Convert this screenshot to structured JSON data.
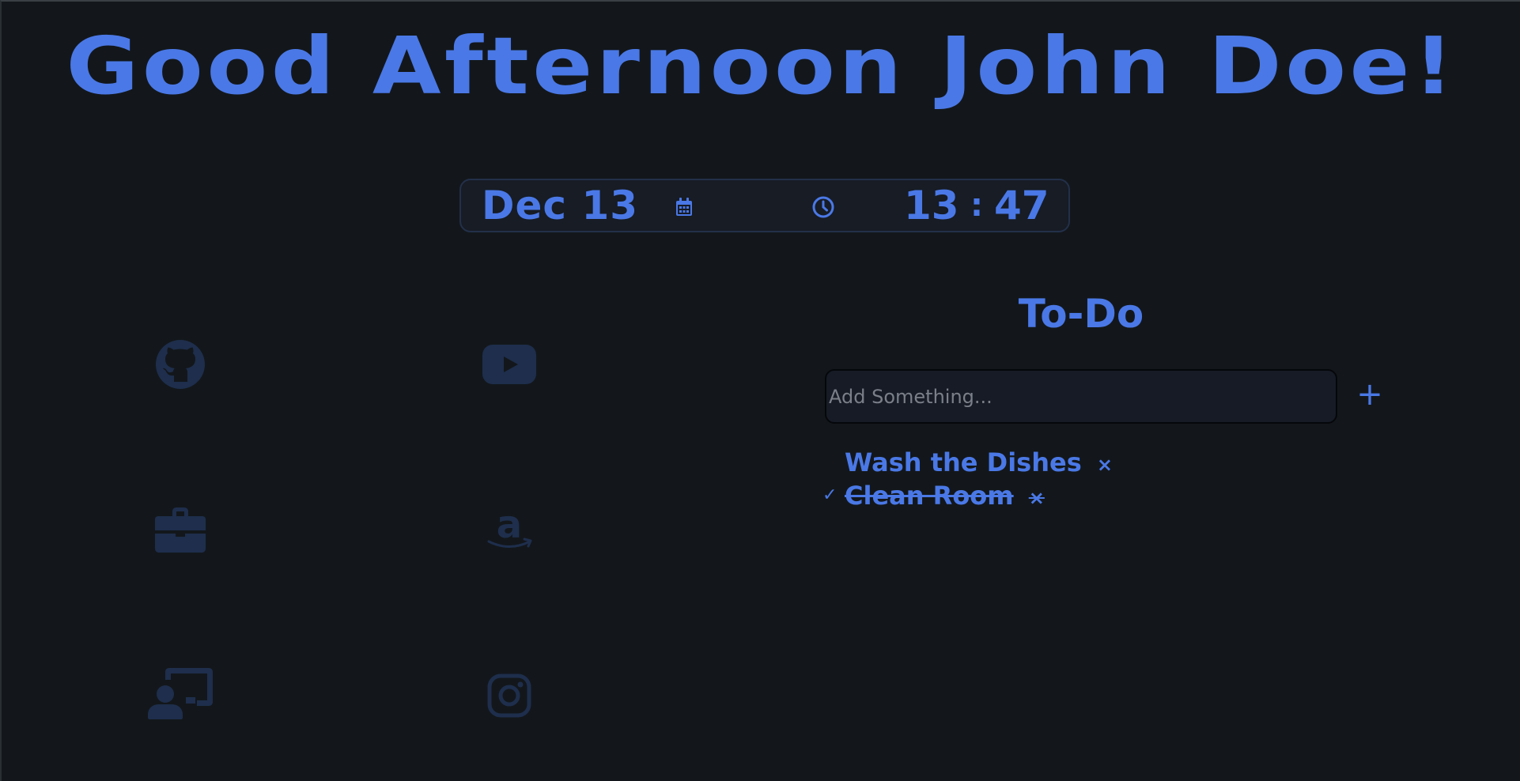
{
  "greeting": "Good Afternoon John Doe!",
  "datetime": {
    "date": "Dec  13",
    "hour": "13",
    "separator": ":",
    "minute": "47",
    "calendar_icon": "calendar-icon",
    "clock_icon": "clock-icon"
  },
  "links": [
    {
      "icon": "github-icon"
    },
    {
      "icon": "youtube-icon"
    },
    {
      "icon": "briefcase-icon"
    },
    {
      "icon": "amazon-icon"
    },
    {
      "icon": "classroom-icon"
    },
    {
      "icon": "instagram-icon"
    }
  ],
  "todo": {
    "title": "To-Do",
    "input_placeholder": "Add Something...",
    "add_label": "+",
    "items": [
      {
        "text": "Wash the Dishes",
        "remove": "×",
        "done": false
      },
      {
        "text": "Clean Room",
        "remove": "×",
        "done": true,
        "check": "✓"
      }
    ]
  },
  "colors": {
    "accent": "#4a78e6",
    "background": "#13171b",
    "link_icon": "#1e2e4c"
  }
}
